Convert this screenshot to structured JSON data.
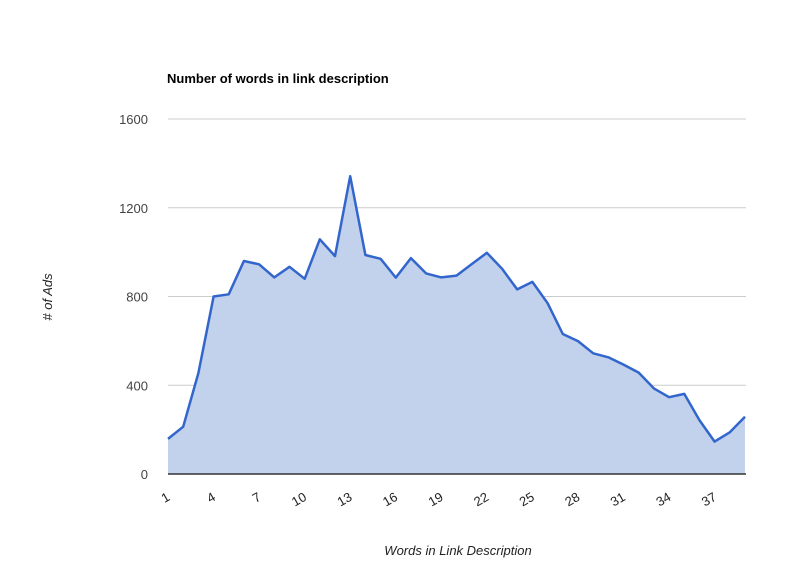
{
  "chart_data": {
    "type": "area",
    "title": "Number of words in link description",
    "xlabel": "Words in Link Description",
    "ylabel": "# of Ads",
    "x": [
      1,
      2,
      3,
      4,
      5,
      6,
      7,
      8,
      9,
      10,
      11,
      12,
      13,
      14,
      15,
      16,
      17,
      18,
      19,
      20,
      21,
      22,
      23,
      24,
      25,
      26,
      27,
      28,
      29,
      30,
      31,
      32,
      33,
      34,
      35,
      36,
      37,
      38,
      39
    ],
    "x_tick_labels": [
      "1",
      "4",
      "7",
      "10",
      "13",
      "16",
      "19",
      "22",
      "25",
      "28",
      "31",
      "34",
      "37"
    ],
    "x_tick_values": [
      1,
      4,
      7,
      10,
      13,
      16,
      19,
      22,
      25,
      28,
      31,
      34,
      37
    ],
    "y_tick_labels": [
      "0",
      "400",
      "800",
      "1200",
      "1600"
    ],
    "y_tick_values": [
      0,
      400,
      800,
      1200,
      1600
    ],
    "ylim": [
      0,
      1600
    ],
    "xlim": [
      1,
      39
    ],
    "grid": true,
    "legend": "none",
    "series": [
      {
        "name": "# of Ads",
        "color": "#3366cc",
        "fill_color": "#c2d1ec",
        "values": [
          158,
          213,
          455,
          800,
          810,
          960,
          945,
          886,
          934,
          880,
          1058,
          982,
          1342,
          987,
          970,
          885,
          973,
          904,
          886,
          894,
          946,
          997,
          925,
          832,
          866,
          770,
          631,
          599,
          544,
          526,
          493,
          457,
          386,
          346,
          361,
          243,
          146,
          188,
          258
        ]
      }
    ]
  }
}
